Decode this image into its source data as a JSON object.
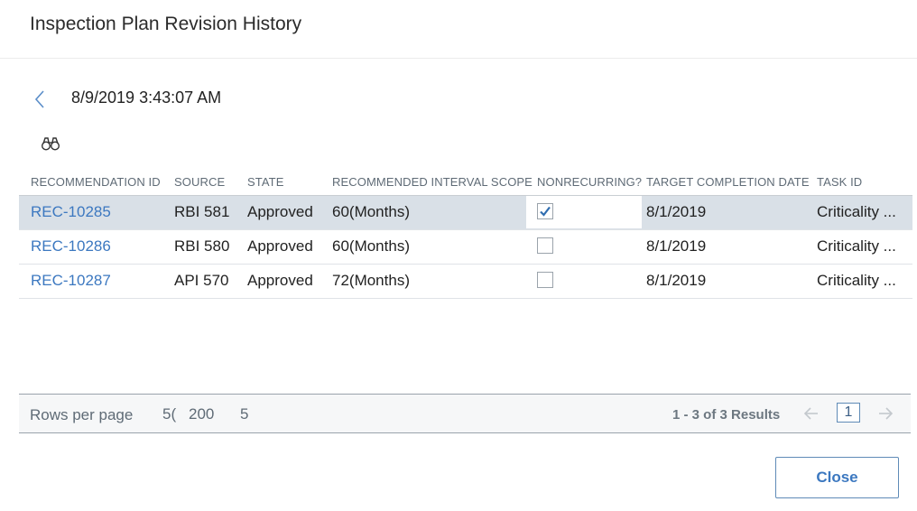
{
  "dialog": {
    "title": "Inspection Plan Revision History"
  },
  "revision": {
    "date": "8/9/2019 3:43:07 AM"
  },
  "icons": {
    "back": "chevron-left-icon",
    "search": "binoculars-icon",
    "prev": "arrow-left-icon",
    "next": "arrow-right-icon",
    "check": "checkmark-icon"
  },
  "colors": {
    "link": "#3c78c0",
    "selected_row": "#d9e0e7",
    "border": "#9aa3ab"
  },
  "table": {
    "columns": [
      "RECOMMENDATION ID",
      "SOURCE",
      "STATE",
      "RECOMMENDED INTERVAL SCOPE",
      "NONRECURRING?",
      "TARGET COMPLETION DATE",
      "TASK ID"
    ],
    "rows": [
      {
        "id": "REC-10285",
        "source": "RBI 581",
        "state": "Approved",
        "interval": "60(Months)",
        "nonrecurring": true,
        "target_date": "8/1/2019",
        "task_id": "Criticality ...",
        "selected": true
      },
      {
        "id": "REC-10286",
        "source": "RBI 580",
        "state": "Approved",
        "interval": "60(Months)",
        "nonrecurring": false,
        "target_date": "8/1/2019",
        "task_id": "Criticality ...",
        "selected": false
      },
      {
        "id": "REC-10287",
        "source": "API 570",
        "state": "Approved",
        "interval": "72(Months)",
        "nonrecurring": false,
        "target_date": "8/1/2019",
        "task_id": "Criticality ...",
        "selected": false
      }
    ]
  },
  "pager": {
    "rows_per_page_label": "Rows per page",
    "options": [
      "5(",
      "200",
      "5"
    ],
    "results": "1 - 3 of 3 Results",
    "current_page": "1"
  },
  "footer": {
    "close_label": "Close"
  }
}
